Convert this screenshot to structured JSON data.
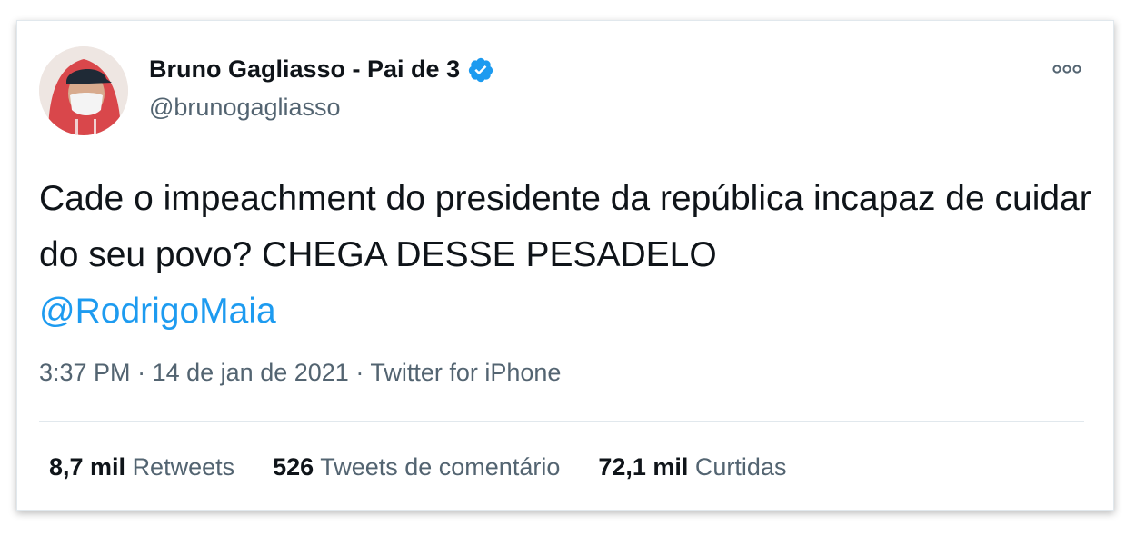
{
  "tweet": {
    "author_name": "Bruno Gagliasso - Pai de 3",
    "handle": "@brunogagliasso",
    "verified": true,
    "text": "Cade o impeachment do presidente da república incapaz de cuidar do seu povo? CHEGA DESSE PESADELO ",
    "mention": "@RodrigoMaia",
    "time": "3:37 PM",
    "separator": "·",
    "date": "14 de jan de 2021",
    "source": "Twitter for iPhone"
  },
  "stats": [
    {
      "count": "8,7 mil",
      "label": "Retweets"
    },
    {
      "count": "526",
      "label": "Tweets de comentário"
    },
    {
      "count": "72,1 mil",
      "label": "Curtidas"
    }
  ],
  "icons": {
    "verified": "verified-badge-icon",
    "more": "more-options-icon"
  },
  "colors": {
    "accent": "#1d9bf0",
    "text": "#0f1419",
    "secondary": "#536471",
    "border": "#e1e8ed"
  }
}
